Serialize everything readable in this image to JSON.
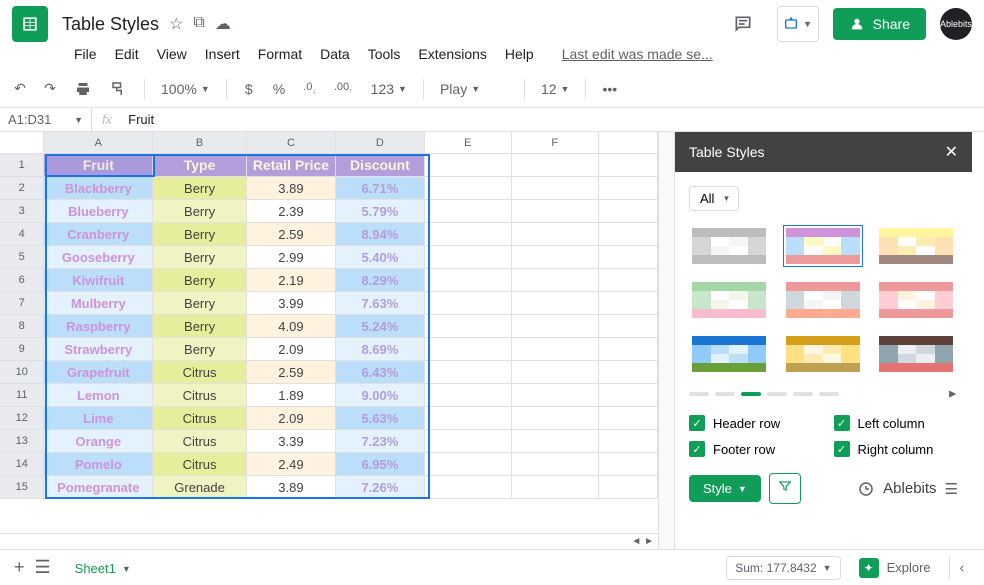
{
  "doc": {
    "title": "Table Styles",
    "last_edit": "Last edit was made se..."
  },
  "menus": [
    "File",
    "Edit",
    "View",
    "Insert",
    "Format",
    "Data",
    "Tools",
    "Extensions",
    "Help"
  ],
  "share_label": "Share",
  "avatar_label": "Ablebits",
  "toolbar": {
    "zoom": "100%",
    "currency": "$",
    "percent": "%",
    "dec_dec": ".0",
    "dec_inc": ".00",
    "numfmt": "123",
    "font": "Play",
    "fontsize": "12"
  },
  "name_box": "A1:D31",
  "formula_value": "Fruit",
  "columns": [
    "A",
    "B",
    "C",
    "D",
    "E",
    "F"
  ],
  "headers": [
    "Fruit",
    "Type",
    "Retail Price",
    "Discount"
  ],
  "rows": [
    {
      "a": "Blackberry",
      "b": "Berry",
      "c": "3.89",
      "d": "6.71%"
    },
    {
      "a": "Blueberry",
      "b": "Berry",
      "c": "2.39",
      "d": "5.79%"
    },
    {
      "a": "Cranberry",
      "b": "Berry",
      "c": "2.59",
      "d": "8.94%"
    },
    {
      "a": "Gooseberry",
      "b": "Berry",
      "c": "2.99",
      "d": "5.40%"
    },
    {
      "a": "Kiwifruit",
      "b": "Berry",
      "c": "2.19",
      "d": "8.29%"
    },
    {
      "a": "Mulberry",
      "b": "Berry",
      "c": "3.99",
      "d": "7.63%"
    },
    {
      "a": "Raspberry",
      "b": "Berry",
      "c": "4.09",
      "d": "5.24%"
    },
    {
      "a": "Strawberry",
      "b": "Berry",
      "c": "2.09",
      "d": "8.69%"
    },
    {
      "a": "Grapefruit",
      "b": "Citrus",
      "c": "2.59",
      "d": "6.43%"
    },
    {
      "a": "Lemon",
      "b": "Citrus",
      "c": "1.89",
      "d": "9.00%"
    },
    {
      "a": "Lime",
      "b": "Citrus",
      "c": "2.09",
      "d": "5.63%"
    },
    {
      "a": "Orange",
      "b": "Citrus",
      "c": "3.39",
      "d": "7.23%"
    },
    {
      "a": "Pomelo",
      "b": "Citrus",
      "c": "2.49",
      "d": "6.95%"
    },
    {
      "a": "Pomegranate",
      "b": "Grenade",
      "c": "3.89",
      "d": "7.26%"
    }
  ],
  "sidebar": {
    "title": "Table Styles",
    "filter": "All",
    "checks": {
      "header": "Header row",
      "footer": "Footer row",
      "left": "Left column",
      "right": "Right column"
    },
    "style_btn": "Style",
    "brand": "Ablebits"
  },
  "bottom": {
    "sheet": "Sheet1",
    "sum": "Sum: 177.8432",
    "explore": "Explore"
  }
}
